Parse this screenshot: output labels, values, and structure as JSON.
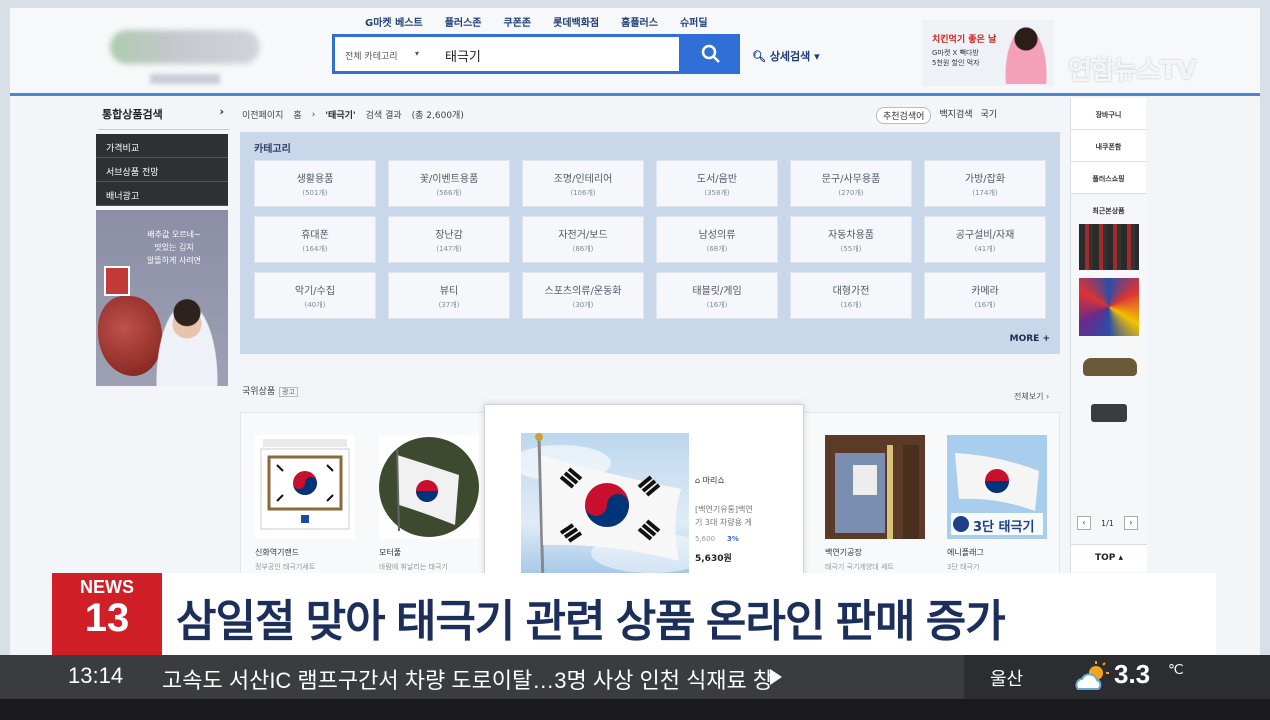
{
  "header": {
    "top_nav": [
      "G마켓 베스트",
      "플러스존",
      "쿠폰존",
      "롯데백화점",
      "홈플러스",
      "슈퍼딜"
    ],
    "search": {
      "category": "전체 카테고리",
      "query": "태극기"
    },
    "detail_search": "상세검색",
    "banner": {
      "title": "치킨먹기 좋은 날",
      "subtitle": "G마켓 X 빽다방\n5천원 할인 먹자"
    },
    "watermark": "연합뉴스TV"
  },
  "left_sidebar": {
    "title": "통합상품검색",
    "menu": [
      "가격비교",
      "서브상품 전망",
      "배너광고"
    ],
    "ad_text": "배추값 오르네~\n맛있는 김치\n알뜰하게 사려면"
  },
  "breadcrumb": {
    "prev": "이전페이지",
    "home": "홈",
    "query": "'태극기'",
    "result_label": "검색 결과",
    "count": "(총 2,600개)",
    "right": [
      "추천검색어",
      "백지검색",
      "국기"
    ]
  },
  "categories": {
    "title": "카테고리",
    "more": "MORE",
    "items": [
      {
        "name": "생활용품",
        "count": "(501개)"
      },
      {
        "name": "꽃/이벤트용품",
        "count": "(566개)"
      },
      {
        "name": "조명/인테리어",
        "count": "(106개)"
      },
      {
        "name": "도서/음반",
        "count": "(358개)"
      },
      {
        "name": "문구/사무용품",
        "count": "(270개)"
      },
      {
        "name": "가방/잡화",
        "count": "(174개)"
      },
      {
        "name": "휴대폰",
        "count": "(164개)"
      },
      {
        "name": "장난감",
        "count": "(147개)"
      },
      {
        "name": "자전거/보드",
        "count": "(86개)"
      },
      {
        "name": "남성의류",
        "count": "(68개)"
      },
      {
        "name": "자동차용품",
        "count": "(55개)"
      },
      {
        "name": "공구설비/자재",
        "count": "(41개)"
      },
      {
        "name": "악기/수집",
        "count": "(40개)"
      },
      {
        "name": "뷰티",
        "count": "(37개)"
      },
      {
        "name": "스포츠의류/운동화",
        "count": "(30개)"
      },
      {
        "name": "태블릿/게임",
        "count": "(16개)"
      },
      {
        "name": "대형가전",
        "count": "(16개)"
      },
      {
        "name": "카메라",
        "count": "(16개)"
      }
    ]
  },
  "products": {
    "header": "국위상품",
    "tag": "광고",
    "more": "전체보기",
    "items": [
      {
        "seller": "신화역기랜드",
        "desc": "정부공인  태극기세트"
      },
      {
        "seller": "모터풀",
        "desc": "바람에 휘날리는 태극기"
      },
      {
        "seller": "백연기공장",
        "desc": "태극기 국기게양대 세트"
      },
      {
        "seller": "에니플래그",
        "desc": "3단 태극기"
      }
    ],
    "featured": {
      "seller": "마리쇼",
      "desc": "[백연기유통]백연\n기 3대 차량용 게",
      "old_price": "5,600",
      "discount": "3%",
      "price": "5,630원"
    },
    "flag_banner_text": "3단 태극기"
  },
  "right_sidebar": {
    "buttons": [
      "장바구니",
      "내쿠폰함",
      "플러스쇼핑"
    ],
    "recent": "최근본상품",
    "page": "1/1",
    "top": "TOP"
  },
  "news": {
    "label": "NEWS",
    "number": "13",
    "headline": "삼일절 맞아 태극기 관련 상품 온라인 판매 증가",
    "time": "13:14",
    "ticker": "고속도 서산IC 램프구간서 차량 도로이탈…3명 사상     인천 식재료 창",
    "weather_city": "울산",
    "weather_temp": "3.3",
    "weather_unit": "℃"
  },
  "colors": {
    "accent": "#2f6fd6",
    "news_red": "#d01f26",
    "headline_navy": "#1c2f5a"
  }
}
